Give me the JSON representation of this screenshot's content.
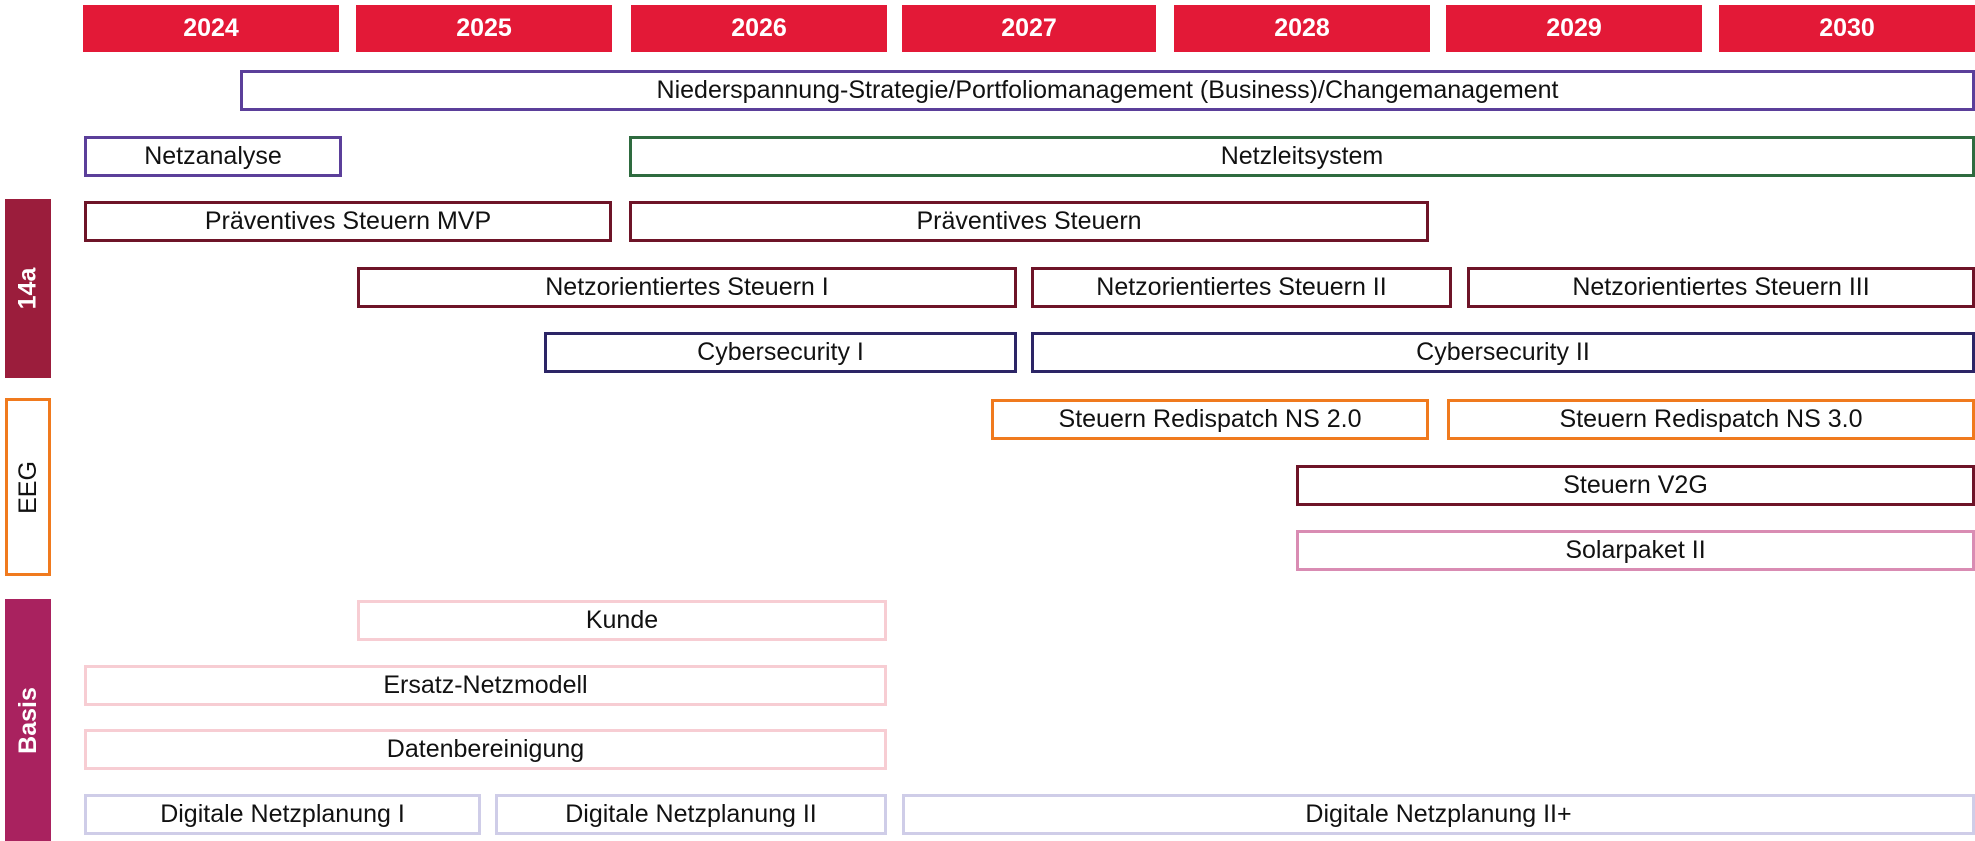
{
  "years": [
    "2024",
    "2025",
    "2026",
    "2027",
    "2028",
    "2029",
    "2030"
  ],
  "categories": {
    "c14a": {
      "label": "14a",
      "color": "#9b1d3c"
    },
    "eeg": {
      "label": "EEG",
      "color": "#f07a1e"
    },
    "basis": {
      "label": "Basis",
      "color": "#a9225f"
    }
  },
  "bars": {
    "niederspannung": "Niederspannung-Strategie/Portfoliomanagement (Business)/Changemanagement",
    "netzanalyse": "Netzanalyse",
    "netzleitsystem": "Netzleitsystem",
    "praeventiv_mvp": "Präventives Steuern MVP",
    "praeventiv": "Präventives Steuern",
    "netzorient_1": "Netzorientiertes Steuern I",
    "netzorient_2": "Netzorientiertes Steuern II",
    "netzorient_3": "Netzorientiertes Steuern III",
    "cyber_1": "Cybersecurity I",
    "cyber_2": "Cybersecurity II",
    "redispatch_2": "Steuern Redispatch NS 2.0",
    "redispatch_3": "Steuern Redispatch NS 3.0",
    "v2g": "Steuern V2G",
    "solarpaket": "Solarpaket II",
    "kunde": "Kunde",
    "ersatz": "Ersatz-Netzmodell",
    "datenbereinigung": "Datenbereinigung",
    "dnp_1": "Digitale Netzplanung I",
    "dnp_2": "Digitale Netzplanung II",
    "dnp_2plus": "Digitale Netzplanung II+"
  }
}
